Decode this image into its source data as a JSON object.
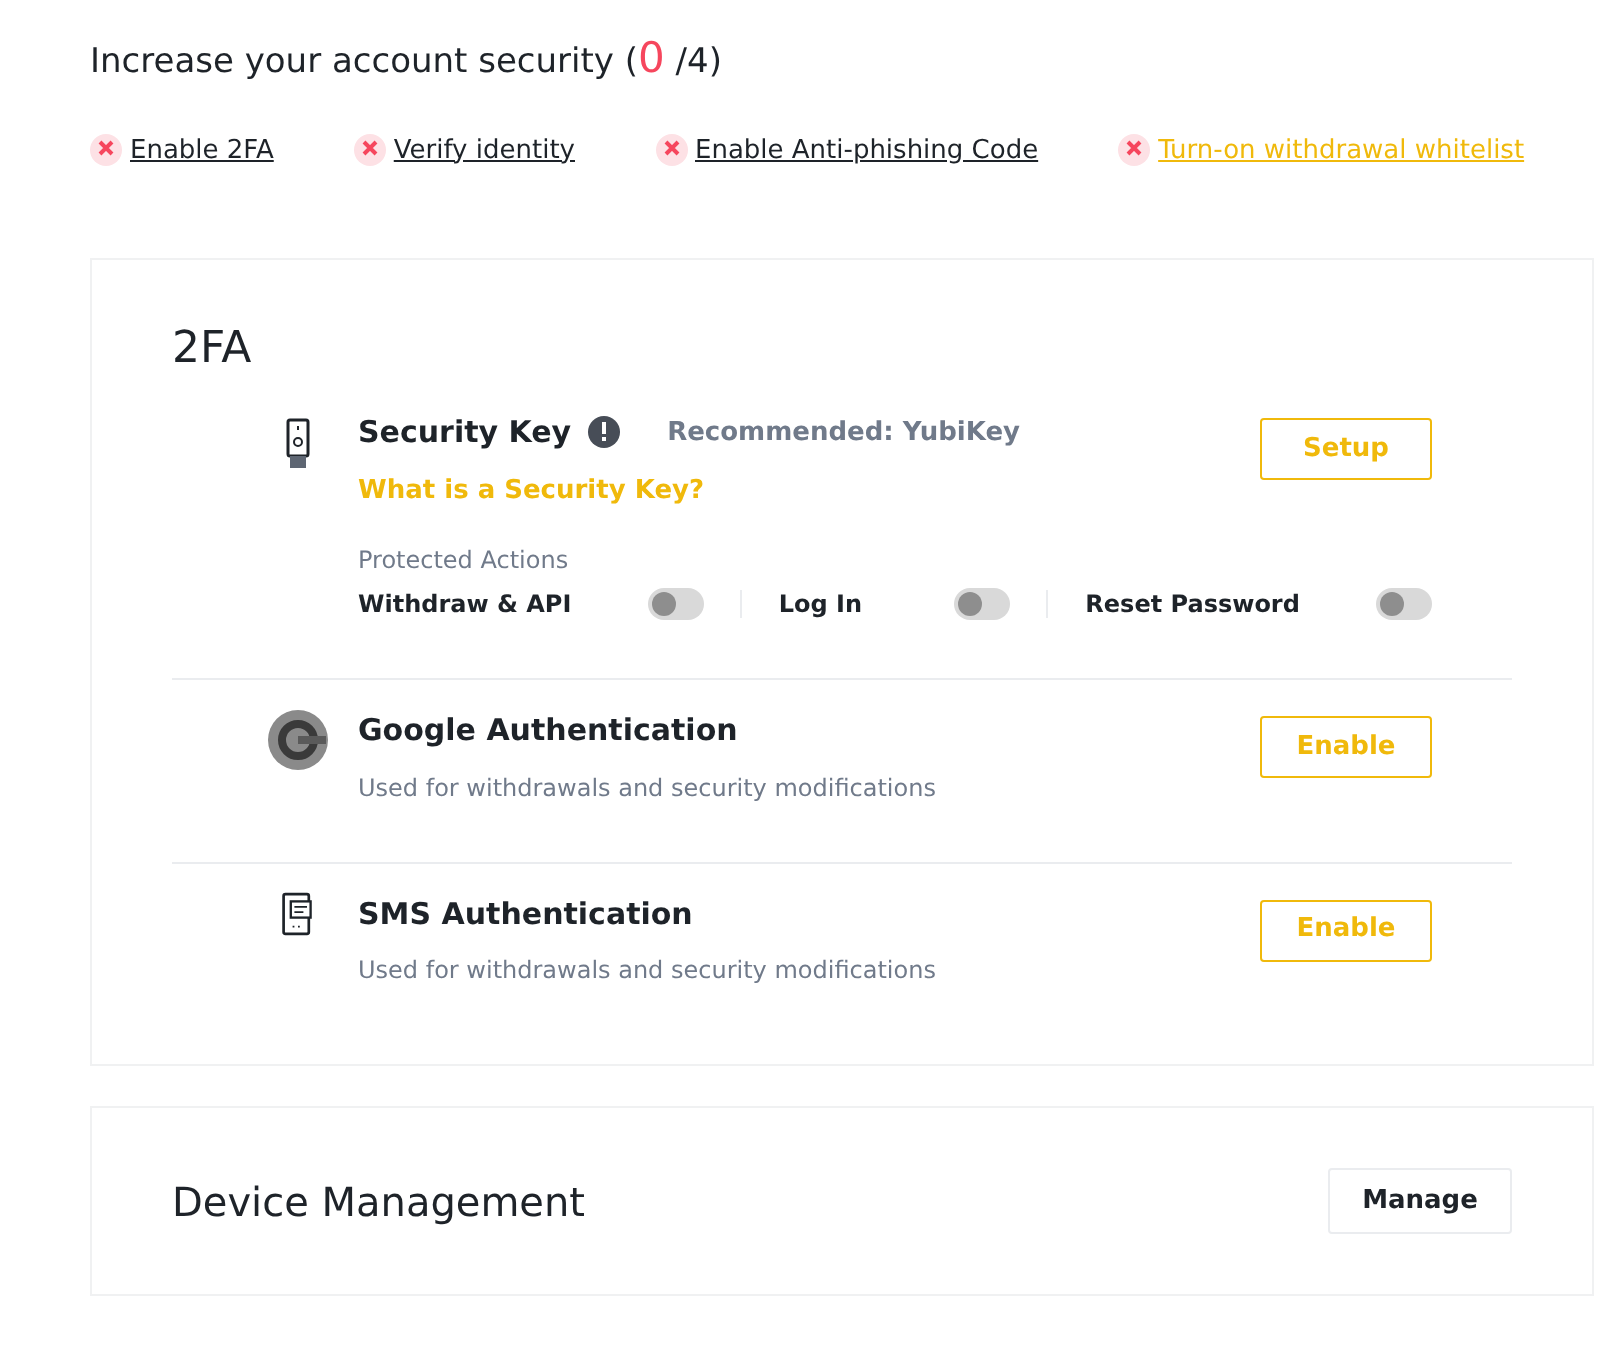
{
  "header": {
    "title_start": "Increase your account security (",
    "score": "0",
    "title_end": " /4)"
  },
  "checklist": [
    {
      "label": "Enable 2FA",
      "done": false,
      "highlighted": false
    },
    {
      "label": "Verify identity",
      "done": false,
      "highlighted": false
    },
    {
      "label": "Enable Anti-phishing Code",
      "done": false,
      "highlighted": false
    },
    {
      "label": "Turn-on withdrawal whitelist",
      "done": false,
      "highlighted": true
    }
  ],
  "twofa": {
    "title": "2FA",
    "methods": [
      {
        "kind": "key",
        "name": "Security Key",
        "recommended": "Recommended: YubiKey",
        "link": "What is a Security Key?",
        "button": "Setup",
        "protected_label": "Protected Actions",
        "actions": [
          {
            "label": "Withdraw & API",
            "on": false
          },
          {
            "label": "Log In",
            "on": false
          },
          {
            "label": "Reset Password",
            "on": false
          }
        ]
      },
      {
        "kind": "google",
        "name": "Google Authentication",
        "description": "Used for withdrawals and security modifications",
        "button": "Enable"
      },
      {
        "kind": "sms",
        "name": "SMS Authentication",
        "description": "Used for withdrawals and security modifications",
        "button": "Enable"
      }
    ]
  },
  "device": {
    "title": "Device Management",
    "button": "Manage"
  }
}
